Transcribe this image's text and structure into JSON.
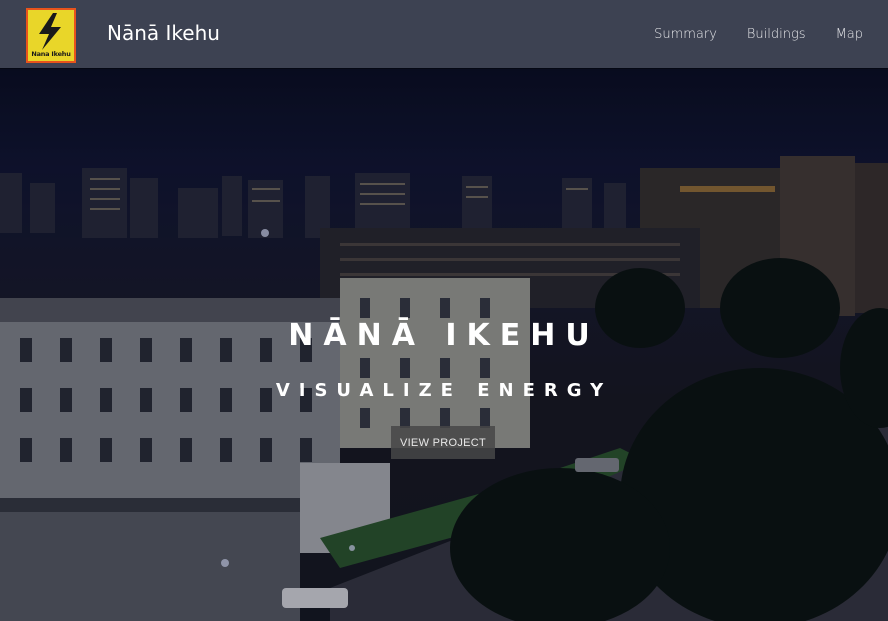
{
  "navbar": {
    "logo_text": "Nana Ikehu",
    "brand": "Nānā Ikehu",
    "links": [
      "Summary",
      "Buildings",
      "Map"
    ]
  },
  "hero": {
    "title": "NĀNĀ IKEHU",
    "subtitle": "VISUALIZE ENERGY",
    "button_label": "VIEW PROJECT"
  },
  "colors": {
    "navbar_bg": "#3d4252",
    "logo_bg": "#e9d629",
    "logo_border": "#e8541c",
    "button_bg": "#464648"
  },
  "icons": [
    "lightning-bolt-icon"
  ]
}
